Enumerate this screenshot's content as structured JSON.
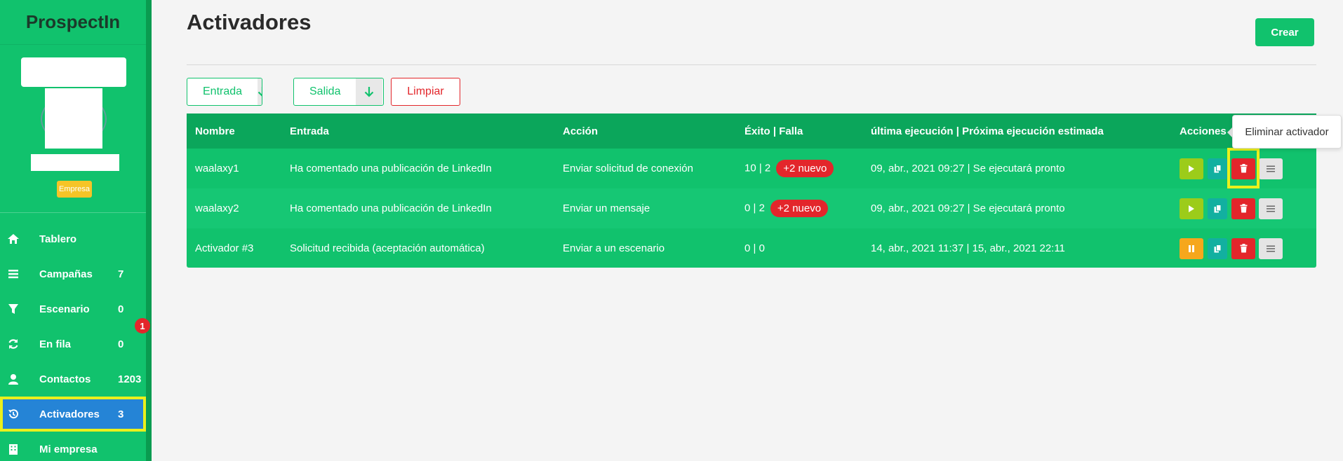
{
  "sidebar": {
    "brand": "ProspectIn",
    "badge": "Empresa",
    "items": [
      {
        "label": "Tablero",
        "count": "",
        "icon": "home-icon"
      },
      {
        "label": "Campañas",
        "count": "7",
        "icon": "list-icon"
      },
      {
        "label": "Escenario",
        "count": "0",
        "icon": "filter-icon"
      },
      {
        "label": "En fila",
        "count": "0",
        "icon": "refresh-icon",
        "badge": "1"
      },
      {
        "label": "Contactos",
        "count": "1203",
        "icon": "user-icon"
      },
      {
        "label": "Activadores",
        "count": "3",
        "icon": "history-icon",
        "active": true
      },
      {
        "label": "Mi empresa",
        "count": "",
        "icon": "building-icon"
      }
    ]
  },
  "header": {
    "title": "Activadores",
    "create_label": "Crear"
  },
  "filters": {
    "entrada": "Entrada",
    "salida": "Salida",
    "limpiar": "Limpiar"
  },
  "table": {
    "columns": [
      "Nombre",
      "Entrada",
      "Acción",
      "Éxito | Falla",
      "última ejecución | Próxima ejecución estimada",
      "Acciones"
    ],
    "rows": [
      {
        "nombre": "waalaxy1",
        "entrada": "Ha comentado una publicación de LinkedIn",
        "accion": "Enviar solicitud de conexión",
        "exito": "10 | 2",
        "nuevo": "+2 nuevo",
        "ultima": "09, abr., 2021 09:27 | Se ejecutará pronto",
        "state": "play"
      },
      {
        "nombre": "waalaxy2",
        "entrada": "Ha comentado una publicación de LinkedIn",
        "accion": "Enviar un mensaje",
        "exito": "0 | 2",
        "nuevo": "+2 nuevo",
        "ultima": "09, abr., 2021 09:27 | Se ejecutará pronto",
        "state": "play"
      },
      {
        "nombre": "Activador #3",
        "entrada": "Solicitud recibida (aceptación automática)",
        "accion": "Enviar a un escenario",
        "exito": "0 | 0",
        "nuevo": "",
        "ultima": "14, abr., 2021 11:37 | 15, abr., 2021 22:11",
        "state": "pause"
      }
    ]
  },
  "tooltip": "Eliminar activador",
  "colors": {
    "brand_green": "#11c26d",
    "header_green": "#0ba65b",
    "active_blue": "#2584d6",
    "highlight_yellow": "#eaf01c",
    "danger_red": "#e3262b"
  }
}
